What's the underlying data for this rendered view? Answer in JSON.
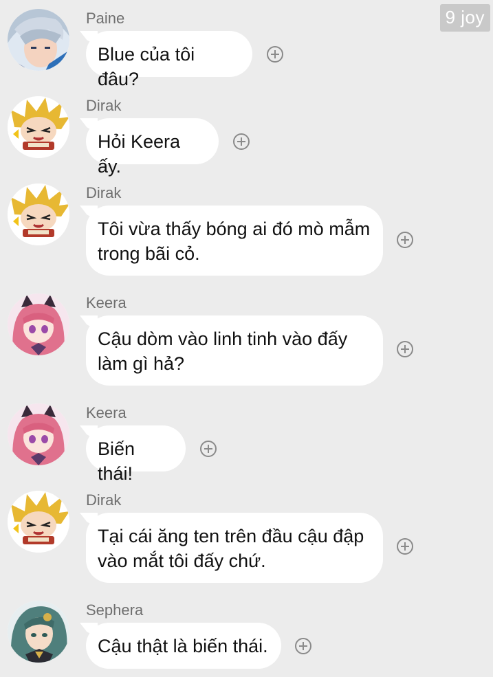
{
  "watermark": "9 joy",
  "messages": [
    {
      "sender": "Paine",
      "text": "Blue của tôi đâu?",
      "avatar": "paine-avatar"
    },
    {
      "sender": "Dirak",
      "text": "Hỏi Keera ấy.",
      "avatar": "dirak-avatar"
    },
    {
      "sender": "Dirak",
      "text": "Tôi vừa thấy bóng ai đó mò mẫm trong bãi cỏ.",
      "avatar": "dirak-avatar"
    },
    {
      "sender": "Keera",
      "text": "Cậu dòm vào linh tinh vào đấy làm gì hả?",
      "avatar": "keera-avatar"
    },
    {
      "sender": "Keera",
      "text": "Biến thái!",
      "avatar": "keera-avatar"
    },
    {
      "sender": "Dirak",
      "text": "Tại cái ăng ten trên đầu cậu đập vào mắt tôi đấy chứ.",
      "avatar": "dirak-avatar"
    },
    {
      "sender": "Sephera",
      "text": "Cậu thật là biến thái.",
      "avatar": "sephera-avatar"
    }
  ],
  "colors": {
    "background": "#ececec",
    "bubble": "#ffffff",
    "sender_name": "#6f6f6f",
    "plus_icon": "#8a8a8a",
    "watermark_bg": "#c9c9c9"
  }
}
